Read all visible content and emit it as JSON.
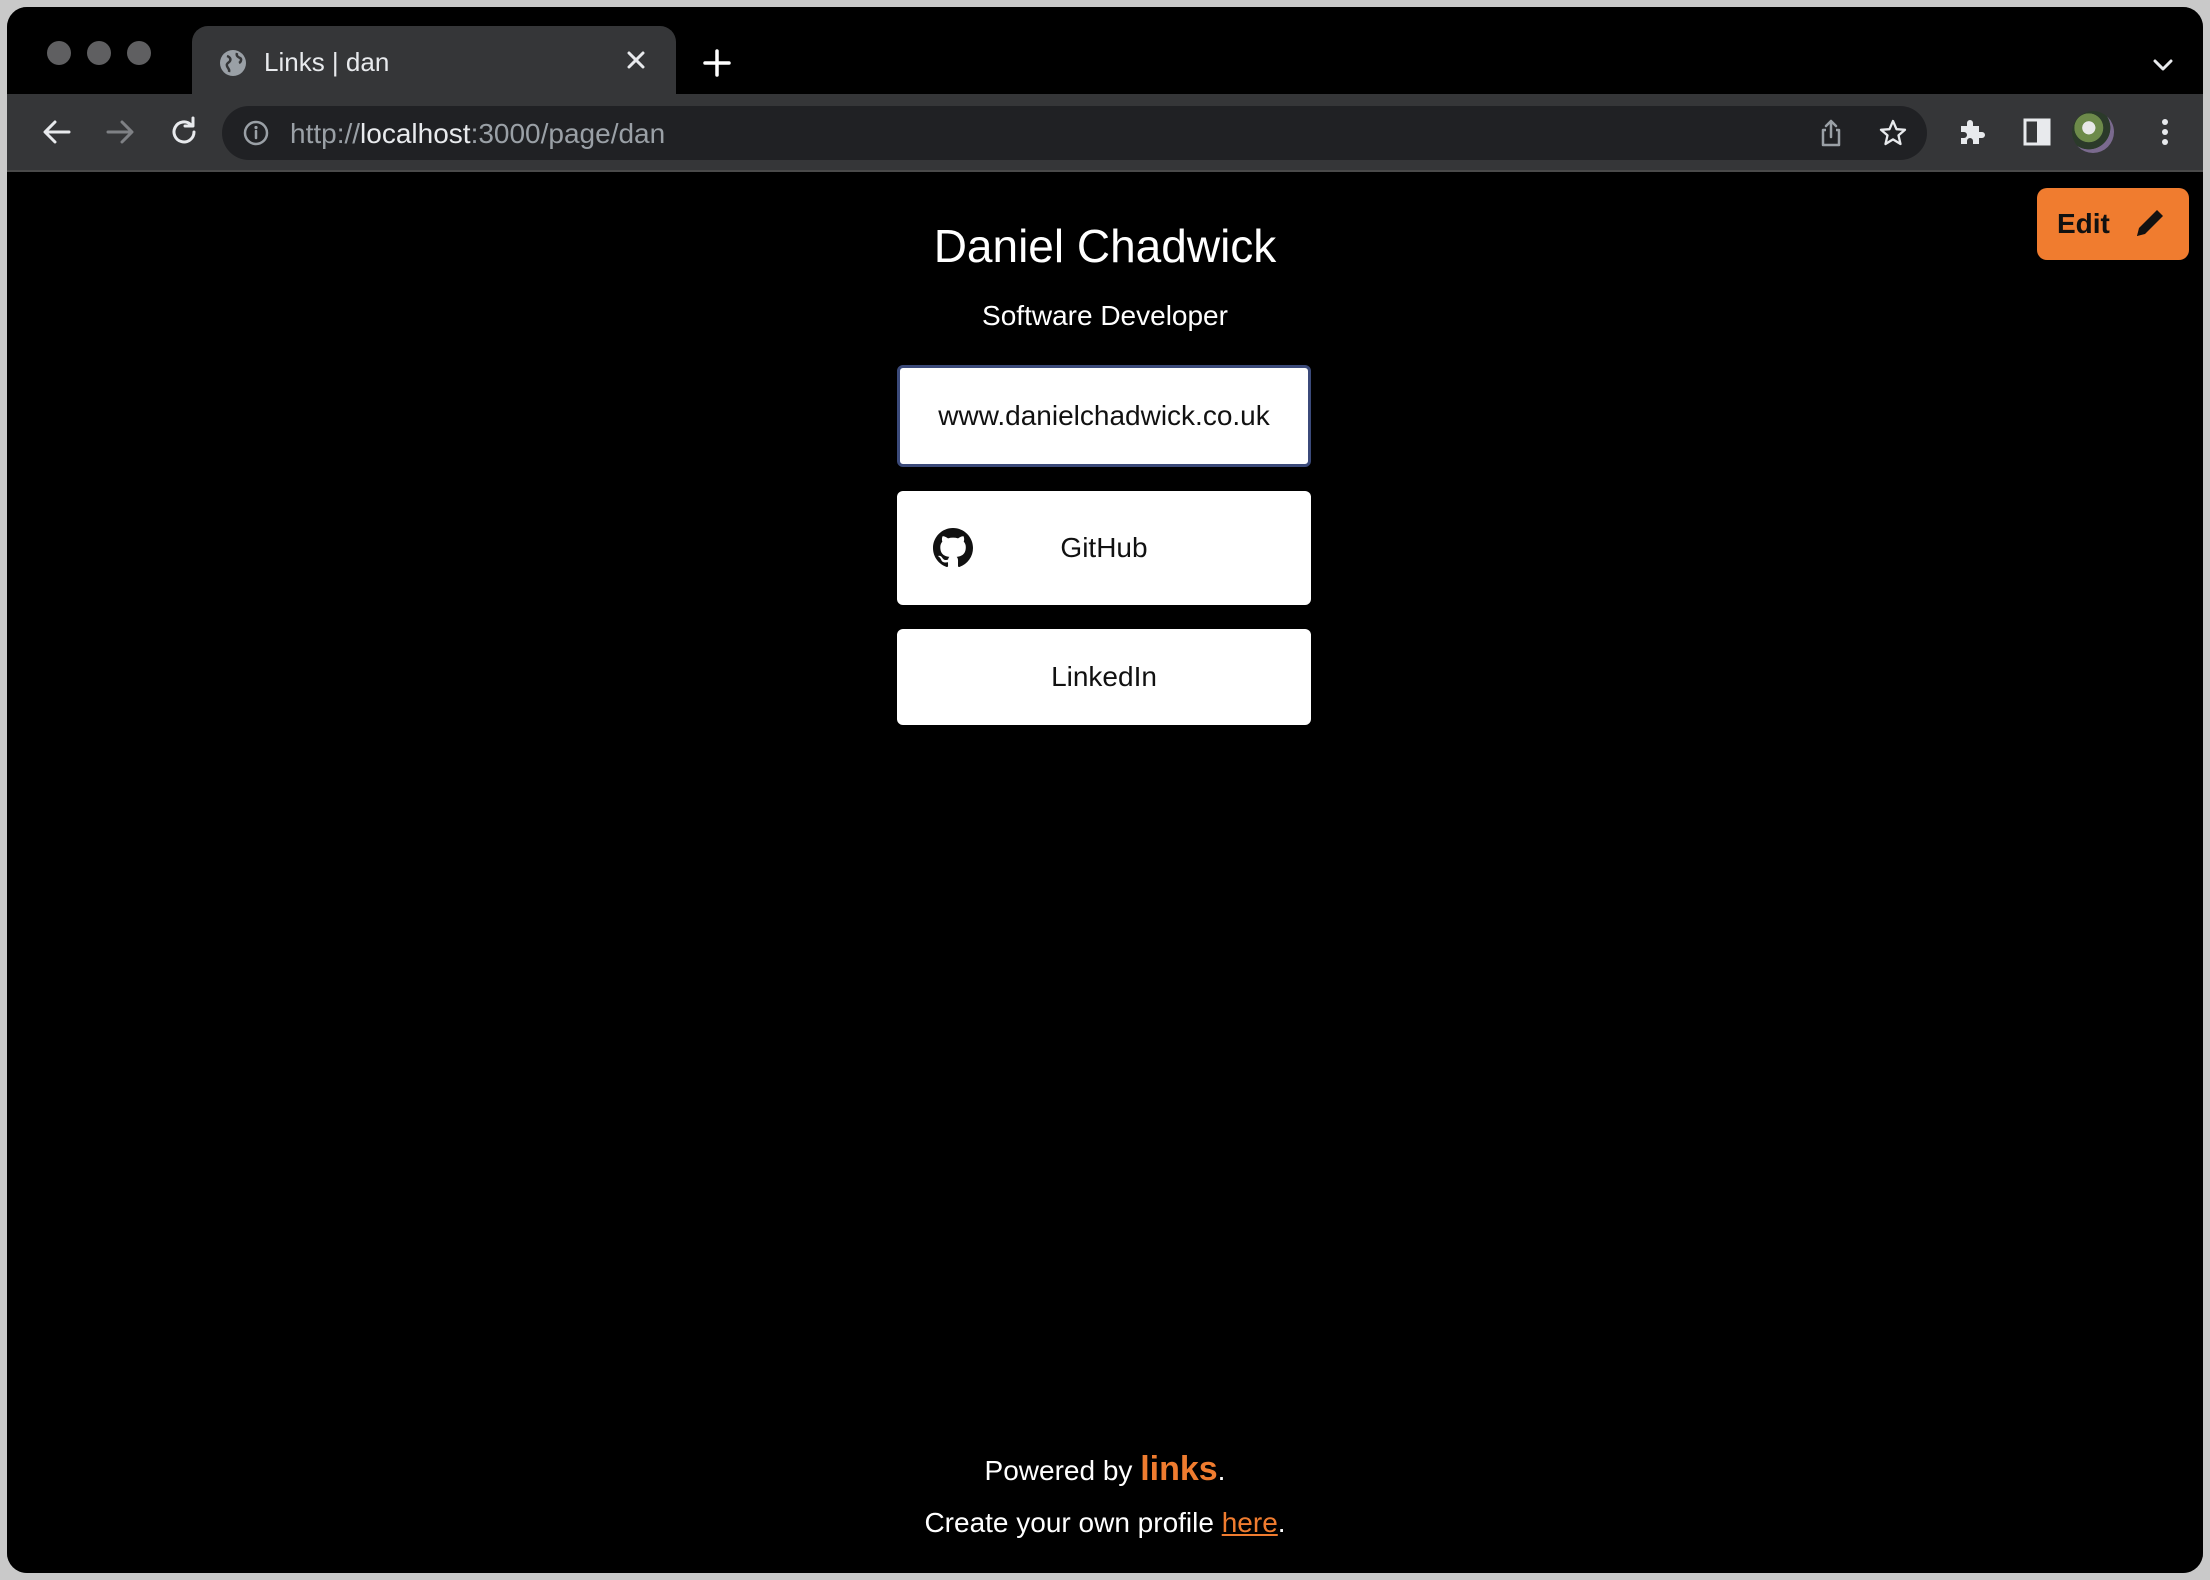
{
  "browser": {
    "tab": {
      "title": "Links | dan"
    },
    "url": {
      "prefix": "http://",
      "host": "localhost",
      "path": ":3000/page/dan"
    }
  },
  "page": {
    "edit_label": "Edit",
    "name": "Daniel Chadwick",
    "subtitle": "Software Developer",
    "links": [
      {
        "label": "www.danielchadwick.co.uk"
      },
      {
        "label": "GitHub",
        "icon": "github-icon"
      },
      {
        "label": "LinkedIn"
      }
    ],
    "footer": {
      "powered_by": "Powered by ",
      "brand": "links",
      "period": ".",
      "create_text": "Create your own profile ",
      "here": "here",
      "create_period": "."
    }
  },
  "colors": {
    "accent": "#f07c2f",
    "background": "#000000",
    "card": "#ffffff"
  }
}
